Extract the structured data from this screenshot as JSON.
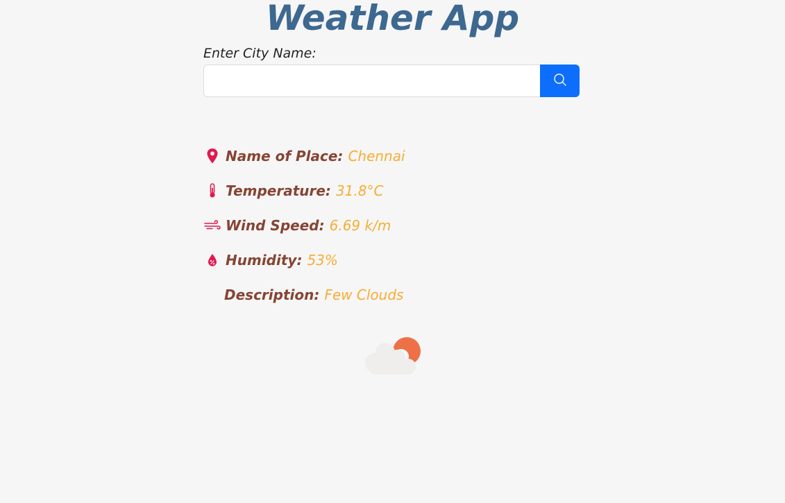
{
  "app": {
    "title": "Weather App"
  },
  "search": {
    "label": "Enter City Name:",
    "value": "",
    "placeholder": "",
    "button_icon": "search-icon"
  },
  "weather": {
    "place": {
      "label": "Name of Place:",
      "value": "Chennai",
      "icon": "map-pin-icon"
    },
    "temperature": {
      "label": "Temperature:",
      "value": "31.8°C",
      "icon": "thermometer-icon"
    },
    "wind": {
      "label": "Wind Speed:",
      "value": "6.69 k/m",
      "icon": "wind-icon"
    },
    "humidity": {
      "label": "Humidity:",
      "value": "53%",
      "icon": "humidity-drop-icon"
    },
    "description": {
      "label": "Description:",
      "value": "Few Clouds"
    }
  },
  "colors": {
    "title": "#3d6890",
    "label": "#864433",
    "value": "#f7ad33",
    "icon": "#e0194f",
    "button": "#0d6efd",
    "sun": "#ee7047",
    "cloud": "#efeeec"
  }
}
